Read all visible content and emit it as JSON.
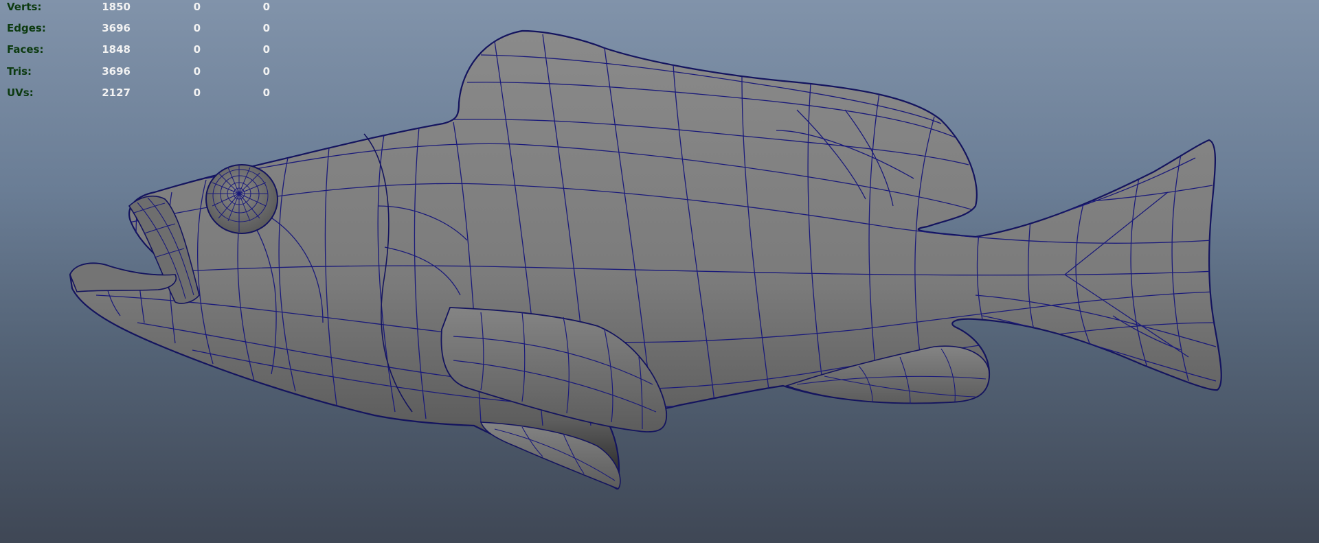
{
  "hud": {
    "rows": [
      {
        "label": "Verts:",
        "values": [
          "1850",
          "0",
          "0"
        ]
      },
      {
        "label": "Edges:",
        "values": [
          "3696",
          "0",
          "0"
        ]
      },
      {
        "label": "Faces:",
        "values": [
          "1848",
          "0",
          "0"
        ]
      },
      {
        "label": "Tris:",
        "values": [
          "3696",
          "0",
          "0"
        ]
      },
      {
        "label": "UVs:",
        "values": [
          "2127",
          "0",
          "0"
        ]
      }
    ]
  },
  "viewport": {
    "background_top": "#8193aa",
    "background_bottom": "#3f4755",
    "mesh_fill": "#7b7b7b",
    "wire_color": "#1a1a7a",
    "object": "fish-mesh"
  }
}
